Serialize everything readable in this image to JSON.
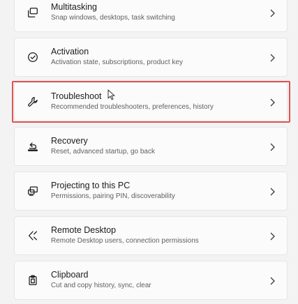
{
  "settings_items": [
    {
      "icon": "multitasking-icon",
      "title": "Multitasking",
      "description": "Snap windows, desktops, task switching"
    },
    {
      "icon": "activation-icon",
      "title": "Activation",
      "description": "Activation state, subscriptions, product key"
    },
    {
      "icon": "wrench-icon",
      "title": "Troubleshoot",
      "description": "Recommended troubleshooters, preferences, history"
    },
    {
      "icon": "recovery-icon",
      "title": "Recovery",
      "description": "Reset, advanced startup, go back"
    },
    {
      "icon": "projector-icon",
      "title": "Projecting to this PC",
      "description": "Permissions, pairing PIN, discoverability"
    },
    {
      "icon": "remote-desktop-icon",
      "title": "Remote Desktop",
      "description": "Remote Desktop users, connection permissions"
    },
    {
      "icon": "clipboard-icon",
      "title": "Clipboard",
      "description": "Cut and copy history, sync, clear"
    }
  ],
  "highlighted_item": "Troubleshoot",
  "colors": {
    "highlight": "#e05252",
    "card_background": "#fbfbfb",
    "page_background": "#f3f3f3"
  }
}
